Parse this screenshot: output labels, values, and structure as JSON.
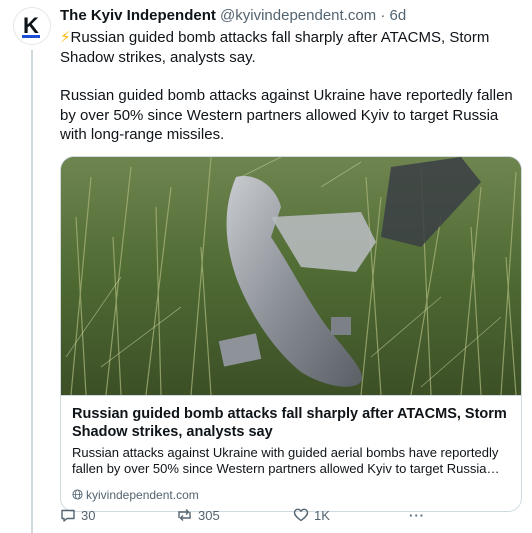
{
  "post": {
    "author_name": "The Kyiv Independent",
    "author_handle": "@kyivindependent.com",
    "separator": "·",
    "time": "6d",
    "bolt": "⚡",
    "headline": "Russian guided bomb attacks fall sharply after ATACMS, Storm Shadow strikes, analysts say.",
    "body": "Russian guided bomb attacks against Ukraine have reportedly fallen by over 50% since Western partners allowed Kyiv to target Russia with long-range missiles."
  },
  "avatar": {
    "letter": "K",
    "icon": "kyiv-independent-logo"
  },
  "card": {
    "image_icon": "bomb-debris-in-grass-photo",
    "title": "Russian guided bomb attacks fall sharply after ATACMS, Storm Shadow strikes, analysts say",
    "description": "Russian attacks against Ukraine with guided aerial bombs have reportedly fallen by over 50% since Western partners allowed Kyiv to target Russia with...",
    "domain": "kyivindependent.com"
  },
  "actions": {
    "replies": "30",
    "reposts": "305",
    "likes": "1K",
    "more": "···"
  },
  "colors": {
    "text": "#0f1419",
    "muted": "#536471",
    "border": "#cfd9de",
    "bolt": "#f5b70a",
    "logo_accent": "#1d4fd6"
  }
}
